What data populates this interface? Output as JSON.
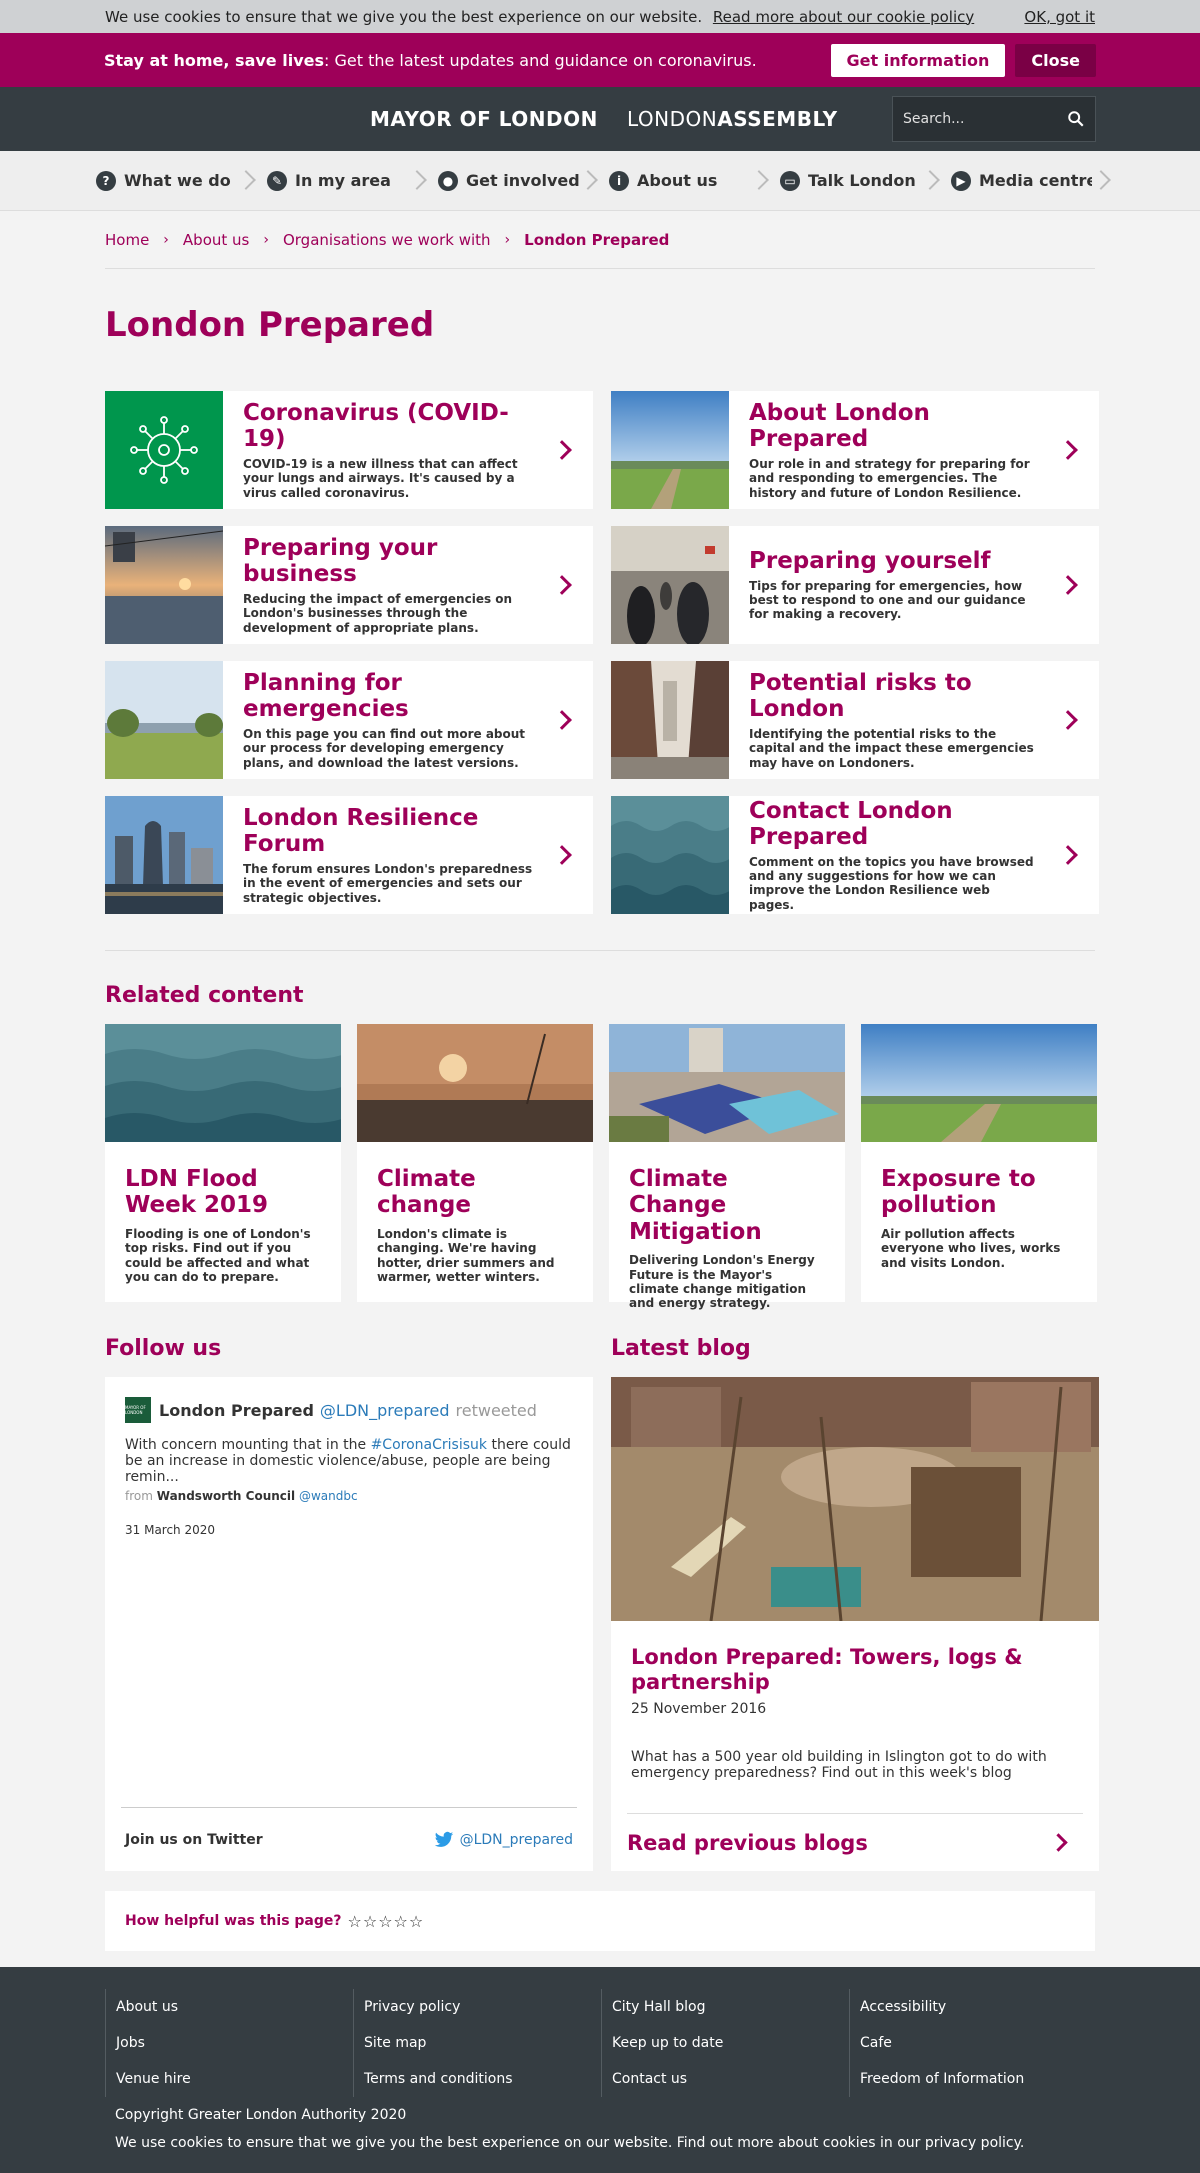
{
  "cookie": {
    "text": "We use cookies to ensure that we give you the best experience on our website.",
    "link": "Read more about our cookie policy",
    "ok": "OK, got it"
  },
  "alert": {
    "bold": "Stay at home, save lives",
    "text": ": Get the latest updates and guidance on coronavirus.",
    "info_btn": "Get information",
    "close_btn": "Close"
  },
  "header": {
    "mayor": "MAYOR OF LONDON",
    "assembly_a": "LONDON",
    "assembly_b": "ASSEMBLY",
    "search_placeholder": "Search..."
  },
  "nav": [
    {
      "label": "What we do",
      "icon": "?"
    },
    {
      "label": "In my area",
      "icon": "✎"
    },
    {
      "label": "Get involved",
      "icon": "●"
    },
    {
      "label": "About us",
      "icon": "i"
    },
    {
      "label": "Talk London",
      "icon": "▭"
    },
    {
      "label": "Media centre",
      "icon": "▶"
    }
  ],
  "breadcrumb": {
    "home": "Home",
    "about": "About us",
    "orgs": "Organisations we work with",
    "current": "London Prepared"
  },
  "page_title": "London Prepared",
  "cards": [
    {
      "title": "Coronavirus (COVID-19)",
      "desc": "COVID-19 is a new illness that can affect your lungs and airways. It's caused by a virus called coronavirus."
    },
    {
      "title": "About London Prepared",
      "desc": "Our role in and strategy for preparing for and responding to emergencies. The history and future of London Resilience."
    },
    {
      "title": "Preparing your business",
      "desc": "Reducing the impact of emergencies on London's businesses through the development of appropriate plans."
    },
    {
      "title": "Preparing yourself",
      "desc": "Tips for preparing for emergencies, how best to respond to one and our guidance for making a recovery."
    },
    {
      "title": "Planning for emergencies",
      "desc": "On this page you can find out more about our process for developing emergency plans, and download the latest versions."
    },
    {
      "title": "Potential risks to London",
      "desc": "Identifying the potential risks to the capital and the impact these emergencies may have on Londoners."
    },
    {
      "title": "London Resilience Forum",
      "desc": "The forum ensures London's preparedness in the event of emergencies and sets our strategic objectives."
    },
    {
      "title": "Contact London Prepared",
      "desc": "Comment on the topics you have browsed and any suggestions for how we can improve the London Resilience web pages."
    }
  ],
  "related_title": "Related content",
  "related": [
    {
      "title": "LDN Flood Week 2019",
      "desc": "Flooding is one of London's top risks. Find out if you could be affected and what you can do to prepare."
    },
    {
      "title": "Climate change",
      "desc": "London's climate is changing. We're having hotter, drier summers and warmer, wetter winters."
    },
    {
      "title": "Climate Change Mitigation",
      "desc": "Delivering London's Energy Future is the Mayor's climate change mitigation and energy strategy."
    },
    {
      "title": "Exposure to pollution",
      "desc": "Air pollution affects everyone who lives, works and visits London."
    }
  ],
  "follow": {
    "title": "Follow us",
    "name": "London Prepared",
    "handle": "@LDN_prepared",
    "retweeted": "retweeted",
    "text_a": "With concern mounting that in the ",
    "hashtag": "#CoronaCrisisuk",
    "text_b": " there could be an increase in domestic violence/abuse, people are being remin...",
    "from_lbl": "from",
    "from_name": "Wandsworth Council",
    "from_handle": "@wandbc",
    "date": "31 March 2020",
    "join": "Join us on Twitter",
    "follow_handle": "@LDN_prepared"
  },
  "blog": {
    "title_section": "Latest blog",
    "title": "London Prepared: Towers, logs & partnership",
    "date": "25 November 2016",
    "desc": "What has a 500 year old building in Islington got to do with emergency preparedness? Find out in this week's blog",
    "read_more": "Read previous blogs"
  },
  "rating": {
    "label": "How helpful was this page?",
    "stars": "☆☆☆☆☆"
  },
  "footer": {
    "col1": [
      "About us",
      "Jobs",
      "Venue hire"
    ],
    "col2": [
      "Privacy policy",
      "Site map",
      "Terms and conditions"
    ],
    "col3": [
      "City Hall blog",
      "Keep up to date",
      "Contact us"
    ],
    "col4": [
      "Accessibility",
      "Cafe",
      "Freedom of Information"
    ],
    "copyright": "Copyright Greater London Authority 2020",
    "cookie_note": "We use cookies to ensure that we give you the best experience on our website. Find out more about cookies in our privacy policy."
  },
  "colors": {
    "brand": "#9e0059",
    "header": "#353d42",
    "twitter": "#2b7bb9"
  }
}
